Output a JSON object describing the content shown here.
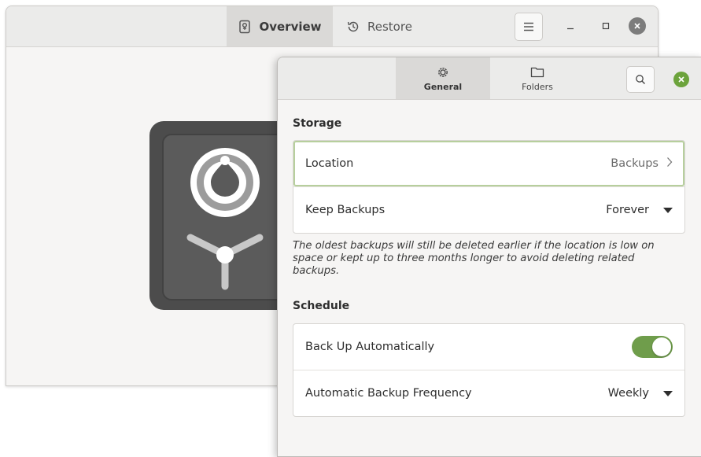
{
  "main_window": {
    "tabs": [
      {
        "label": "Overview",
        "icon": "safe-icon",
        "active": true
      },
      {
        "label": "Restore",
        "icon": "history-icon",
        "active": false
      }
    ],
    "menu_icon": "hamburger-icon"
  },
  "dialog": {
    "tabs": [
      {
        "label": "General",
        "icon": "gear-icon",
        "active": true
      },
      {
        "label": "Folders",
        "icon": "folder-icon",
        "active": false
      }
    ],
    "storage": {
      "title": "Storage",
      "location_label": "Location",
      "location_value": "Backups",
      "keep_label": "Keep Backups",
      "keep_value": "Forever",
      "note": "The oldest backups will still be deleted earlier if the location is low on space or kept up to three months longer to avoid deleting related backups."
    },
    "schedule": {
      "title": "Schedule",
      "auto_label": "Back Up Automatically",
      "auto_enabled": true,
      "frequency_label": "Automatic Backup Frequency",
      "frequency_value": "Weekly"
    }
  },
  "colors": {
    "accent": "#6f9d4b",
    "close_green": "#6ca33c",
    "vault_dark": "#4c4c4c"
  }
}
